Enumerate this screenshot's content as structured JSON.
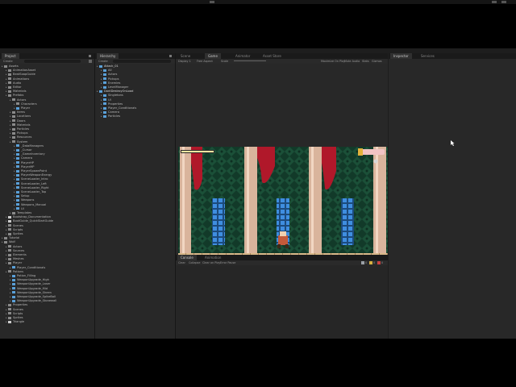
{
  "colors": {
    "panel_bg": "#282828",
    "tab_bg": "#1a1a1a",
    "selection": "#2d5a8a",
    "game_bg": "#16402e",
    "pillar": "#d9b49c",
    "floor": "#d7b98d",
    "curtain": "#b0182a"
  },
  "project": {
    "tab": "Project",
    "search_placeholder": "Create",
    "items": [
      {
        "label": "Assets",
        "depth": 0,
        "icon": "folder-icon"
      },
      {
        "label": "AnimationAsset",
        "depth": 1,
        "icon": "folder-icon"
      },
      {
        "label": "BeatSoapGuide",
        "depth": 1,
        "icon": "folder-icon"
      },
      {
        "label": "Animations",
        "depth": 1,
        "icon": "folder-icon"
      },
      {
        "label": "Audio",
        "depth": 1,
        "icon": "folder-icon"
      },
      {
        "label": "Editor",
        "depth": 1,
        "icon": "folder-icon"
      },
      {
        "label": "Materials",
        "depth": 1,
        "icon": "folder-icon"
      },
      {
        "label": "Prefabs",
        "depth": 1,
        "icon": "folder-icon"
      },
      {
        "label": "Actors",
        "depth": 2,
        "icon": "folder-icon"
      },
      {
        "label": "Characters",
        "depth": 3,
        "icon": "folder-icon"
      },
      {
        "label": "Player",
        "depth": 3,
        "icon": "prefab-icon"
      },
      {
        "label": "Items",
        "depth": 2,
        "icon": "folder-icon"
      },
      {
        "label": "Locations",
        "depth": 2,
        "icon": "folder-icon"
      },
      {
        "label": "Doors",
        "depth": 2,
        "icon": "folder-icon"
      },
      {
        "label": "Materials",
        "depth": 2,
        "icon": "folder-icon"
      },
      {
        "label": "Particles",
        "depth": 2,
        "icon": "folder-icon"
      },
      {
        "label": "Pickups",
        "depth": 2,
        "icon": "folder-icon"
      },
      {
        "label": "Resources",
        "depth": 2,
        "icon": "folder-icon"
      },
      {
        "label": "System",
        "depth": 2,
        "icon": "folder-icon"
      },
      {
        "label": "_DataManagers",
        "depth": 3,
        "icon": "prefab-icon"
      },
      {
        "label": "_Cursor",
        "depth": 3,
        "icon": "prefab-icon"
      },
      {
        "label": "_GameInventory",
        "depth": 3,
        "icon": "prefab-icon"
      },
      {
        "label": "Camera",
        "depth": 3,
        "icon": "prefab-icon"
      },
      {
        "label": "PlayerHP",
        "depth": 3,
        "icon": "prefab-icon"
      },
      {
        "label": "PlayerMP",
        "depth": 3,
        "icon": "prefab-icon"
      },
      {
        "label": "PlayerSpawnPoint",
        "depth": 3,
        "icon": "prefab-icon"
      },
      {
        "label": "PlayerWeaponEnergy",
        "depth": 3,
        "icon": "prefab-icon"
      },
      {
        "label": "SceneLoader_Intro",
        "depth": 3,
        "icon": "prefab-icon"
      },
      {
        "label": "SceneLoader_Left",
        "depth": 3,
        "icon": "prefab-icon"
      },
      {
        "label": "SceneLoader_Right",
        "depth": 3,
        "icon": "prefab-icon"
      },
      {
        "label": "SceneLoader_Top",
        "depth": 3,
        "icon": "prefab-icon"
      },
      {
        "label": "Setup",
        "depth": 3,
        "icon": "prefab-icon"
      },
      {
        "label": "Weapons",
        "depth": 3,
        "icon": "prefab-icon"
      },
      {
        "label": "Weapons_Manual",
        "depth": 3,
        "icon": "prefab-icon"
      },
      {
        "label": "UI",
        "depth": 3,
        "icon": "prefab-icon"
      },
      {
        "label": "Templates",
        "depth": 2,
        "icon": "folder-icon"
      },
      {
        "label": "Bootstrap_Documentation",
        "depth": 1,
        "icon": "doc-icon"
      },
      {
        "label": "BootGuide_QuickStartGuide",
        "depth": 1,
        "icon": "doc-icon"
      },
      {
        "label": "Scenes",
        "depth": 1,
        "icon": "folder-icon"
      },
      {
        "label": "Scripts",
        "depth": 1,
        "icon": "folder-icon"
      },
      {
        "label": "Sprites",
        "depth": 1,
        "icon": "folder-icon"
      },
      {
        "label": "Tutorial",
        "depth": 0,
        "icon": "folder-icon"
      },
      {
        "label": "Wolf",
        "depth": 0,
        "icon": "folder-icon"
      },
      {
        "label": "Actors",
        "depth": 1,
        "icon": "folder-icon"
      },
      {
        "label": "Sources",
        "depth": 1,
        "icon": "folder-icon"
      },
      {
        "label": "Elements",
        "depth": 1,
        "icon": "folder-icon"
      },
      {
        "label": "Meshes",
        "depth": 1,
        "icon": "folder-icon"
      },
      {
        "label": "Player",
        "depth": 1,
        "icon": "folder-icon"
      },
      {
        "label": "Player_Conditionals",
        "depth": 2,
        "icon": "prefab-icon"
      },
      {
        "label": "Potions",
        "depth": 1,
        "icon": "folder-icon"
      },
      {
        "label": "Potion_Filling",
        "depth": 2,
        "icon": "prefab-icon"
      },
      {
        "label": "WeaponUpgrade_High",
        "depth": 2,
        "icon": "prefab-icon"
      },
      {
        "label": "WeaponUpgrade_Laser",
        "depth": 2,
        "icon": "prefab-icon"
      },
      {
        "label": "WeaponUpgrade_Mid",
        "depth": 2,
        "icon": "prefab-icon"
      },
      {
        "label": "WeaponUpgrade_Sheen",
        "depth": 2,
        "icon": "prefab-icon"
      },
      {
        "label": "WeaponUpgrade_SpikeBall",
        "depth": 2,
        "icon": "prefab-icon"
      },
      {
        "label": "WeaponUpgrade_Stonewall",
        "depth": 2,
        "icon": "prefab-icon"
      },
      {
        "label": "Properties",
        "depth": 1,
        "icon": "folder-icon"
      },
      {
        "label": "Scenes",
        "depth": 1,
        "icon": "folder-icon"
      },
      {
        "label": "Scripts",
        "depth": 1,
        "icon": "folder-icon"
      },
      {
        "label": "Sprites",
        "depth": 1,
        "icon": "folder-icon"
      },
      {
        "label": "Triangle",
        "depth": 1,
        "icon": "doc-icon"
      }
    ]
  },
  "hierarchy": {
    "tab": "Hierarchy",
    "create": "Create",
    "items": [
      {
        "label": "Attack_01",
        "depth": 0,
        "icon": "scene-icon"
      },
      {
        "label": "All",
        "depth": 1,
        "icon": "cube-icon"
      },
      {
        "label": "Actors",
        "depth": 1,
        "icon": "cube-icon"
      },
      {
        "label": "Pickups",
        "depth": 1,
        "icon": "cube-icon"
      },
      {
        "label": "Enemies",
        "depth": 1,
        "icon": "cube-icon"
      },
      {
        "label": "LevelManager",
        "depth": 1,
        "icon": "cube-icon"
      },
      {
        "label": "DontDestroyOnLoad",
        "depth": 0,
        "icon": "scene-icon"
      },
      {
        "label": "Singletons",
        "depth": 1,
        "icon": "cube-icon"
      },
      {
        "label": "UI",
        "depth": 1,
        "icon": "cube-icon"
      },
      {
        "label": "Properties",
        "depth": 1,
        "icon": "cube-icon"
      },
      {
        "label": "Player_Conditionals",
        "depth": 1,
        "icon": "cube-icon"
      },
      {
        "label": "Camera",
        "depth": 1,
        "icon": "cube-icon"
      },
      {
        "label": "Particles",
        "depth": 1,
        "icon": "cube-icon"
      }
    ]
  },
  "center": {
    "tabs": [
      "Scene",
      "Game",
      "Animator",
      "Asset Store"
    ],
    "display": "Display 1",
    "aspect": "Free Aspect",
    "scale": "Scale",
    "game_toolbar": [
      "Maximize On Play",
      "Mute Audio",
      "Stats",
      "Gizmos"
    ]
  },
  "console": {
    "tabs": [
      "Console",
      "Animation"
    ],
    "buttons": [
      "Clear",
      "Collapse",
      "Clear on Play",
      "Error Pause"
    ],
    "counts": [
      "0",
      "0",
      "0"
    ]
  },
  "inspector": {
    "tabs": [
      "Inspector",
      "Services"
    ]
  }
}
